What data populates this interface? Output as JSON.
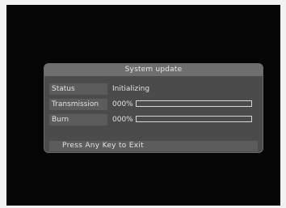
{
  "dialog": {
    "title": "System update",
    "rows": [
      {
        "label": "Status",
        "value": "Initializing"
      },
      {
        "label": "Transmission",
        "value": "000%",
        "progress": 0
      },
      {
        "label": "Burn",
        "value": "000%",
        "progress": 0
      }
    ],
    "footer": "Press Any Key to Exit"
  }
}
